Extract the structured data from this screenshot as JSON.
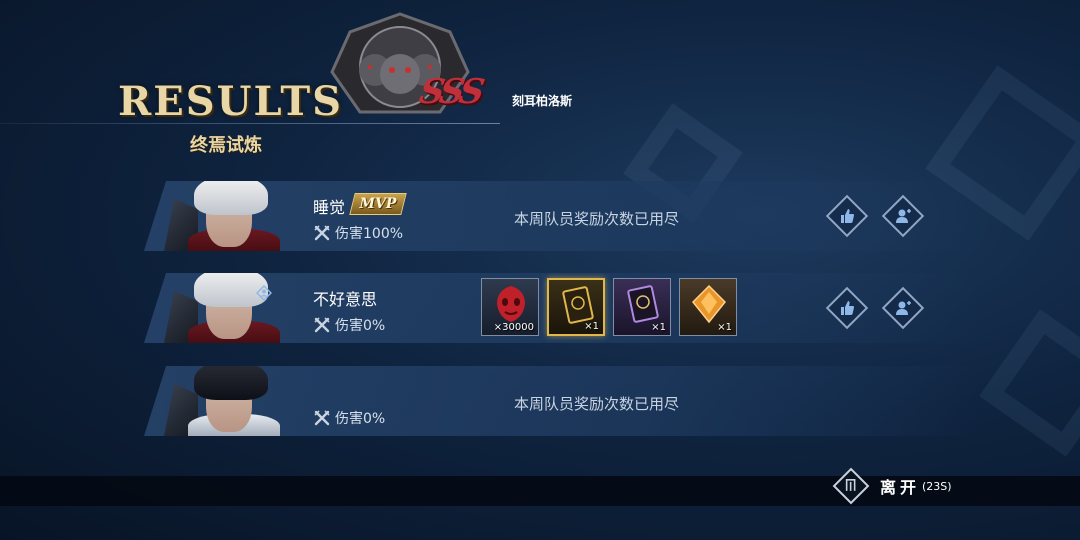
{
  "header": {
    "title": "RESULTS",
    "subtitle": "终焉试炼",
    "boss_name": "刻耳柏洛斯",
    "rank": "SSS"
  },
  "players": [
    {
      "name": "睡觉",
      "mvp": "MVP",
      "damage": "伤害100%",
      "reward_note": "本周队员奖励次数已用尽",
      "hair": "white"
    },
    {
      "name": "不好意思",
      "damage": "伤害0%",
      "is_self": true,
      "hair": "white",
      "rewards": [
        {
          "icon": "red-mask-icon",
          "qty": "×30000",
          "style": "normal"
        },
        {
          "icon": "gold-card-icon",
          "qty": "×1",
          "style": "gold"
        },
        {
          "icon": "purple-card-icon",
          "qty": "×1",
          "style": "purple"
        },
        {
          "icon": "orange-crystal-icon",
          "qty": "×1",
          "style": "orange"
        }
      ]
    },
    {
      "name": "",
      "damage": "伤害0%",
      "reward_note": "本周队员奖励次数已用尽",
      "hair": "black"
    }
  ],
  "footer": {
    "leave_label": "离开",
    "countdown": "(23S)"
  },
  "colors": {
    "accent_gold": "#e9d6a6",
    "rank_red": "#c0303a",
    "background": "#0f2440"
  }
}
